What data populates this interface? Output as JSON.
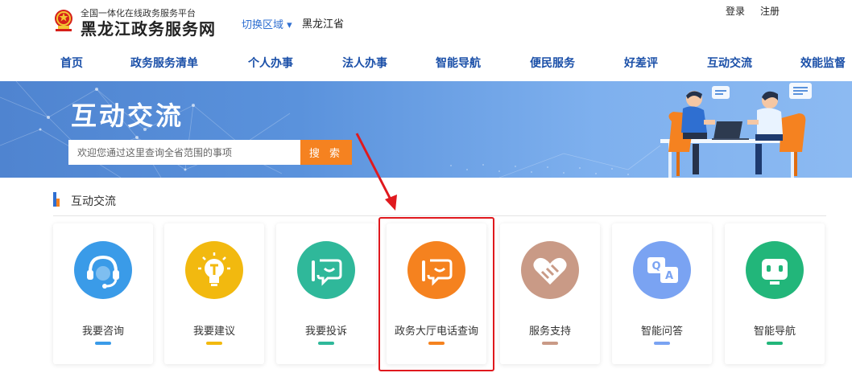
{
  "header": {
    "slogan": "全国一体化在线政务服务平台",
    "site_title": "黑龙江政务服务网",
    "region_switch": "切换区域 ▾",
    "region_name": "黑龙江省",
    "login": "登录",
    "register": "注册"
  },
  "nav": {
    "items": [
      "首页",
      "政务服务清单",
      "个人办事",
      "法人办事",
      "智能导航",
      "便民服务",
      "好差评",
      "互动交流",
      "效能监督"
    ]
  },
  "banner": {
    "title": "互动交流",
    "search_placeholder": "欢迎您通过这里查询全省范围的事项",
    "search_button": "搜 索"
  },
  "section": {
    "title": "互动交流"
  },
  "cards": [
    {
      "label": "我要咨询",
      "icon": "headset-icon",
      "color": "#3a9be8",
      "bar": "#3a9be8"
    },
    {
      "label": "我要建议",
      "icon": "lightbulb-icon",
      "color": "#f2b90f",
      "bar": "#f2b90f"
    },
    {
      "label": "我要投诉",
      "icon": "complaint-chat-icon",
      "color": "#2fb89a",
      "bar": "#2fb89a"
    },
    {
      "label": "政务大厅电话查询",
      "icon": "phone-chat-icon",
      "color": "#f5821f",
      "bar": "#f5821f"
    },
    {
      "label": "服务支持",
      "icon": "handshake-heart-icon",
      "color": "#c99a86",
      "bar": "#c99a86"
    },
    {
      "label": "智能问答",
      "icon": "qa-icon",
      "color": "#7aa3f2",
      "bar": "#7aa3f2"
    },
    {
      "label": "智能导航",
      "icon": "robot-icon",
      "color": "#22b67a",
      "bar": "#22b67a"
    }
  ],
  "colors": {
    "accent": "#f58220",
    "brand": "#1a4fa8",
    "highlight": "#e0191e"
  }
}
